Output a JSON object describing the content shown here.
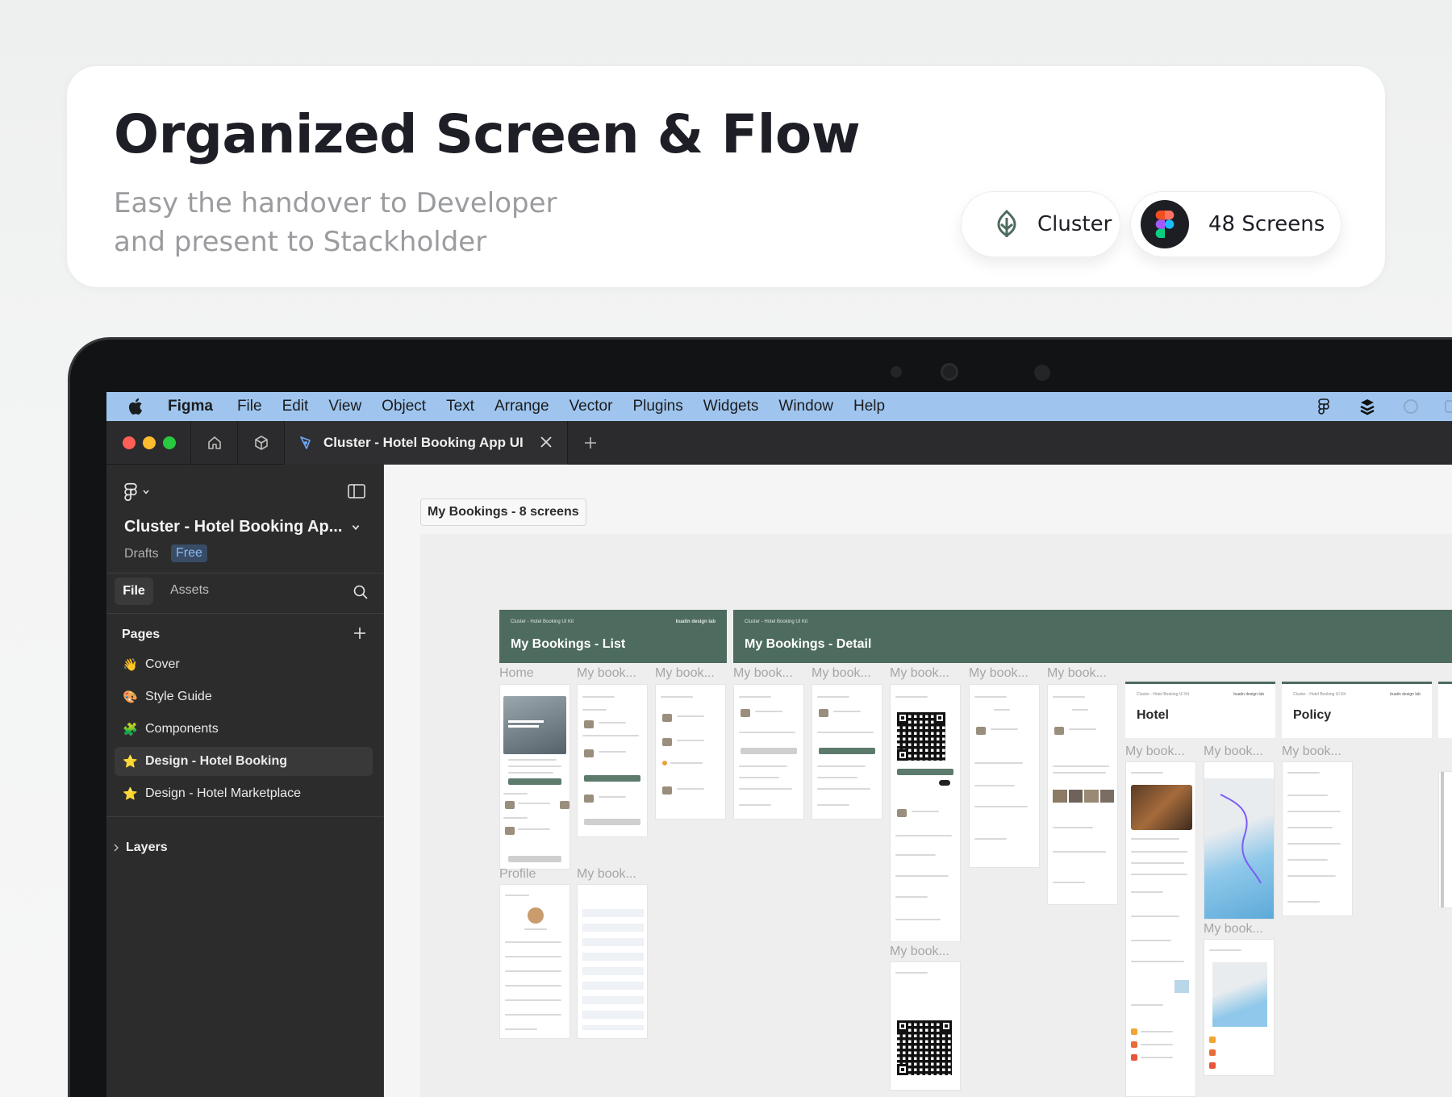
{
  "promo": {
    "title": "Organized Screen & Flow",
    "subtitle_line1": "Easy the handover to Developer",
    "subtitle_line2": "and present to Stackholder",
    "pill_cluster": "Cluster",
    "pill_screens": "48 Screens"
  },
  "menubar": {
    "app": "Figma",
    "items": [
      "File",
      "Edit",
      "View",
      "Object",
      "Text",
      "Arrange",
      "Vector",
      "Plugins",
      "Widgets",
      "Window",
      "Help"
    ]
  },
  "tabbar": {
    "active_tab": "Cluster - Hotel Booking App UI Ki"
  },
  "sidebar": {
    "file_name": "Cluster - Hotel Booking Ap...",
    "drafts": "Drafts",
    "plan": "Free",
    "tab_file": "File",
    "tab_assets": "Assets",
    "pages_title": "Pages",
    "pages": [
      {
        "emoji": "👋",
        "label": "Cover"
      },
      {
        "emoji": "🎨",
        "label": "Style Guide"
      },
      {
        "emoji": "🧩",
        "label": "Components"
      },
      {
        "emoji": "⭐",
        "label": "Design - Hotel Booking"
      },
      {
        "emoji": "⭐",
        "label": "Design - Hotel Marketplace"
      }
    ],
    "layers": "Layers"
  },
  "canvas": {
    "section_label": "My Bookings - 8 screens",
    "header_list": {
      "small": "Cluster - Hotel Booking UI Kit",
      "small_right": "buatin design lab",
      "title": "My Bookings - List"
    },
    "header_detail": {
      "small": "Cluster - Hotel Booking UI Kit",
      "title": "My Bookings - Detail"
    },
    "frame_hotel": {
      "small": "Cluster - Hotel Booking UI Kit",
      "small_right": "buatin design lab",
      "title": "Hotel"
    },
    "frame_policy": {
      "small": "Cluster - Hotel Booking UI Kit",
      "small_right": "buatin design lab",
      "title": "Policy"
    },
    "labels": {
      "home": "Home",
      "profile": "Profile",
      "my_book": "My book..."
    }
  },
  "colors": {
    "accent_green": "#4d6b5e",
    "menubar_blue": "#9fc5ee",
    "figma_dark": "#2c2c2c"
  }
}
